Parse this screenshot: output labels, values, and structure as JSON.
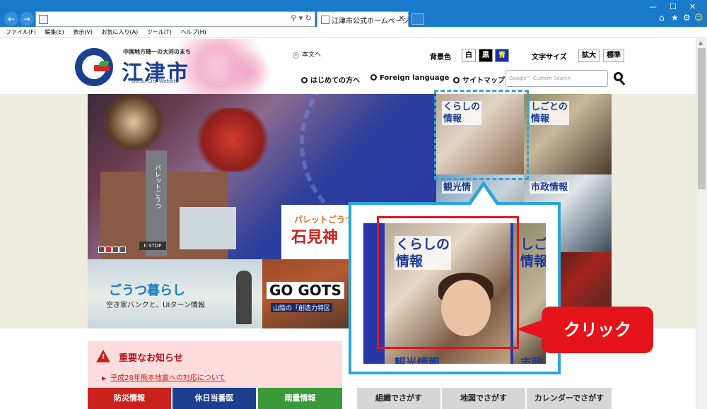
{
  "browser": {
    "tab_title": "江津市公式ホームページ",
    "address_value": "",
    "menu": [
      "ファイル(F)",
      "編集(E)",
      "表示(V)",
      "お気に入り(A)",
      "ツール(T)",
      "ヘルプ(H)"
    ]
  },
  "header": {
    "logo_tagline": "中国地方随一の大河のまち",
    "logo_name": "江津市",
    "logo_en": "Gotsu City Website",
    "skip_link": "本文へ",
    "bg_label": "背景色",
    "bg_options": [
      "白",
      "黒",
      "青"
    ],
    "size_label": "文字サイズ",
    "size_options": [
      "拡大",
      "標準"
    ],
    "links": [
      "はじめての方へ",
      "Foreign language",
      "サイトマップ"
    ],
    "search_placeholder": "Google™ Custom Search"
  },
  "hero": {
    "tower_text": "パレットごうつ",
    "palette_line1": "パレットごうつ",
    "palette_line2": "石見神",
    "stop_label": "II STOP",
    "slides_total": 4,
    "slide_active": 2
  },
  "tiles": {
    "gozu_title": "ごうつ暮らし",
    "gozu_sub": "空き家バンクと、UIターン情報",
    "go_title": "GO GOTS",
    "go_sub": "山陰の「創造力特区"
  },
  "categories": [
    {
      "label": "くらしの\n情報"
    },
    {
      "label": "しごとの\n情報"
    },
    {
      "label": "観光情"
    },
    {
      "label": "市政情報"
    }
  ],
  "alert": {
    "title": "重要なお知らせ",
    "link": "平成28年熊本地震への対応について"
  },
  "bottom_buttons": [
    {
      "label": "防災情報",
      "color": "#c9221c"
    },
    {
      "label": "休日当番医",
      "color": "#1c3f8f"
    },
    {
      "label": "雨量情報",
      "color": "#3a9a3a"
    }
  ],
  "gray_buttons": [
    "組織でさがす",
    "地図でさがす",
    "カレンダーでさがす"
  ],
  "callout": {
    "zoom_label_left": "くらしの\n情報",
    "zoom_label_right": "しご\n情報",
    "zoom_bottom_left": "観光情報",
    "zoom_bottom_right": "市政",
    "click_label": "クリック"
  },
  "colors": {
    "chrome_blue": "#1979ca",
    "logo_blue": "#1c3f8f",
    "accent_red": "#e4141a",
    "callout_blue": "#2aa5dc"
  }
}
